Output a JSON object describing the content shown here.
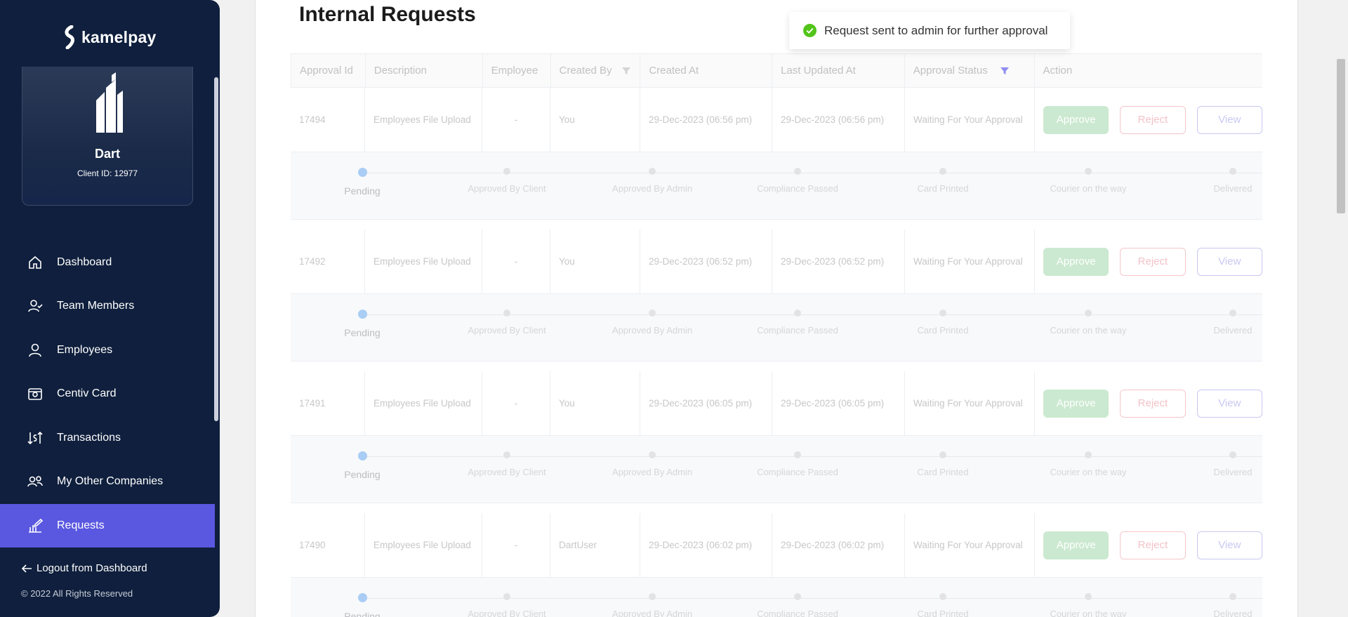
{
  "brand": {
    "name": "kamelpay"
  },
  "client": {
    "name": "Dart",
    "client_id": "Client ID: 12977"
  },
  "nav": [
    {
      "label": "Dashboard",
      "icon": "home-icon",
      "active": false
    },
    {
      "label": "Team Members",
      "icon": "user-check-icon",
      "active": false
    },
    {
      "label": "Employees",
      "icon": "user-icon",
      "active": false
    },
    {
      "label": "Centiv Card",
      "icon": "card-icon",
      "active": false
    },
    {
      "label": "Transactions",
      "icon": "transactions-icon",
      "active": false
    },
    {
      "label": "My Other Companies",
      "icon": "companies-icon",
      "active": false
    },
    {
      "label": "Requests",
      "icon": "requests-icon",
      "active": true
    }
  ],
  "footer": {
    "logout": "Logout from Dashboard",
    "copyright": "© 2022 All Rights Reserved"
  },
  "page": {
    "title": "Internal Requests"
  },
  "toast": {
    "message": "Request sent to admin for further approval",
    "status_color": "#52c41a"
  },
  "table": {
    "columns": [
      "Approval Id",
      "Description",
      "Employee",
      "Created By",
      "Created At",
      "Last Updated At",
      "Approval Status",
      "Action"
    ],
    "actions": {
      "approve": "Approve",
      "reject": "Reject",
      "view": "View"
    },
    "steps": [
      "Pending",
      "Approved By Client",
      "Approved By Admin",
      "Compliance Passed",
      "Card Printed",
      "Courier on the way",
      "Delivered"
    ],
    "rows": [
      {
        "id": "17494",
        "description": "Employees File Upload",
        "employee": "-",
        "created_by": "You",
        "created_at": "29-Dec-2023 (06:56 pm)",
        "updated_at": "29-Dec-2023 (06:56 pm)",
        "status": "Waiting For Your Approval"
      },
      {
        "id": "17492",
        "description": "Employees File Upload",
        "employee": "-",
        "created_by": "You",
        "created_at": "29-Dec-2023 (06:52 pm)",
        "updated_at": "29-Dec-2023 (06:52 pm)",
        "status": "Waiting For Your Approval"
      },
      {
        "id": "17491",
        "description": "Employees File Upload",
        "employee": "-",
        "created_by": "You",
        "created_at": "29-Dec-2023 (06:05 pm)",
        "updated_at": "29-Dec-2023 (06:05 pm)",
        "status": "Waiting For Your Approval"
      },
      {
        "id": "17490",
        "description": "Employees File Upload",
        "employee": "-",
        "created_by": "DartUser",
        "created_at": "29-Dec-2023 (06:02 pm)",
        "updated_at": "29-Dec-2023 (06:02 pm)",
        "status": "Waiting For Your Approval"
      }
    ]
  },
  "colors": {
    "sidebar": "#0f1f3d",
    "active_nav": "#5a58e0",
    "filter_active": "#5a58e0"
  }
}
